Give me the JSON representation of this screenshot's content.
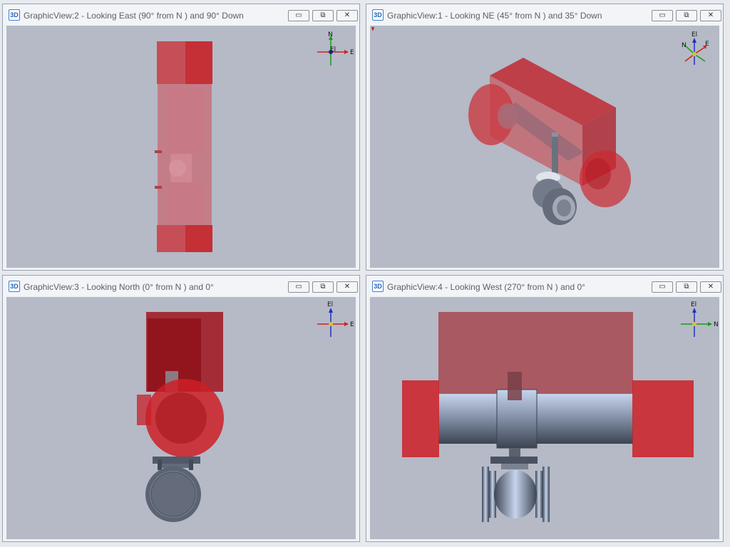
{
  "badge_text": "3D",
  "views": [
    {
      "id": "view2",
      "title": "GraphicView:2 - Looking East (90° from N ) and 90° Down",
      "axes": {
        "up": "N",
        "right": "E",
        "center": "El"
      }
    },
    {
      "id": "view1",
      "title": "GraphicView:1 - Looking NE (45° from N ) and 35° Down",
      "axes": {
        "up": "El",
        "right": "E",
        "left": "N"
      }
    },
    {
      "id": "view3",
      "title": "GraphicView:3 - Looking North (0° from N ) and 0°",
      "axes": {
        "up": "El",
        "right": "E"
      }
    },
    {
      "id": "view4",
      "title": "GraphicView:4 - Looking West (270° from N ) and 0°",
      "axes": {
        "up": "El",
        "right": "N"
      }
    }
  ],
  "controls": {
    "minimize": "▭",
    "restore": "⧉",
    "close": "✕"
  },
  "colors": {
    "pipe_red": "#cc2a30",
    "valve_steel": "#6b7384",
    "viewport_bg": "#b5bac6"
  }
}
